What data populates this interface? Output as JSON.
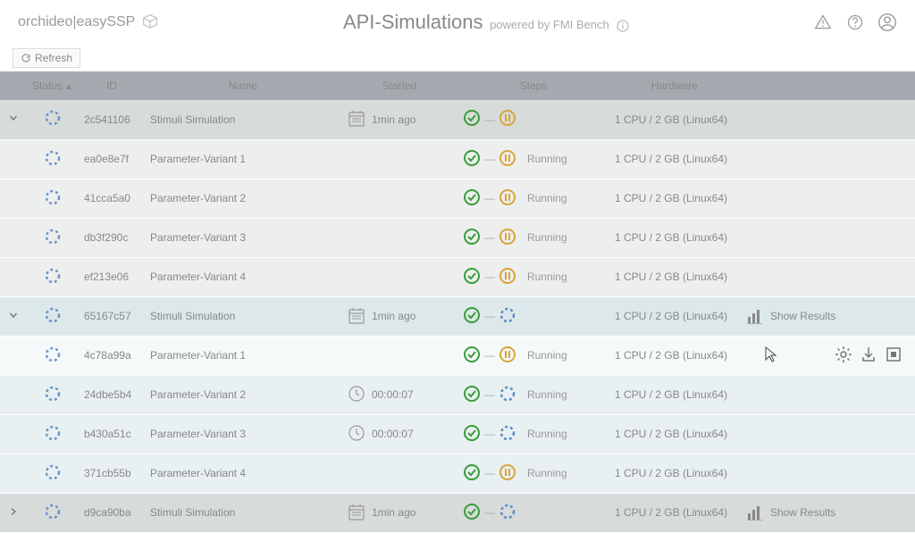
{
  "logo": {
    "text1": "orchideo",
    "sep": " | ",
    "text2": "easySSP"
  },
  "page": {
    "title": "API-Simulations",
    "subtitle": "powered by FMI Bench"
  },
  "toolbar": {
    "refresh": "Refresh"
  },
  "columns": {
    "status": "Status",
    "id": "ID",
    "name": "Name",
    "started": "Started",
    "steps": "Steps",
    "hardware": "Hardware"
  },
  "actions": {
    "showResults": "Show Results"
  },
  "rows": [
    {
      "type": "parent",
      "expand": "down",
      "id": "2c541106",
      "name": "Stimuli Simulation",
      "startedIcon": "cal",
      "started": "1min ago",
      "stepKind": "pause",
      "stepLabel": "",
      "hardware": "1 CPU / 2 GB (Linux64)",
      "actions": ""
    },
    {
      "type": "child",
      "id": "ea0e8e7f",
      "name": "Parameter-Variant 1",
      "started": "",
      "stepKind": "pause",
      "stepLabel": "Running",
      "hardware": "1 CPU / 2 GB (Linux64)",
      "actions": ""
    },
    {
      "type": "child",
      "id": "41cca5a0",
      "name": "Parameter-Variant 2",
      "started": "",
      "stepKind": "pause",
      "stepLabel": "Running",
      "hardware": "1 CPU / 2 GB (Linux64)",
      "actions": ""
    },
    {
      "type": "child",
      "id": "db3f290c",
      "name": "Parameter-Variant 3",
      "started": "",
      "stepKind": "pause",
      "stepLabel": "Running",
      "hardware": "1 CPU / 2 GB (Linux64)",
      "actions": ""
    },
    {
      "type": "child",
      "id": "ef213e06",
      "name": "Parameter-Variant 4",
      "started": "",
      "stepKind": "pause",
      "stepLabel": "Running",
      "hardware": "1 CPU / 2 GB (Linux64)",
      "actions": ""
    },
    {
      "type": "parent-alt",
      "expand": "down",
      "id": "65167c57",
      "name": "Stimuli Simulation",
      "startedIcon": "cal",
      "started": "1min ago",
      "stepKind": "spin",
      "stepLabel": "",
      "hardware": "1 CPU / 2 GB (Linux64)",
      "actions": "results"
    },
    {
      "type": "child-hover",
      "id": "4c78a99a",
      "name": "Parameter-Variant 1",
      "started": "",
      "stepKind": "pause",
      "stepLabel": "Running",
      "hardware": "1 CPU / 2 GB (Linux64)",
      "actions": "icons"
    },
    {
      "type": "child-alt",
      "id": "24dbe5b4",
      "name": "Parameter-Variant 2",
      "startedIcon": "clock",
      "started": "00:00:07",
      "stepKind": "spin",
      "stepLabel": "Running",
      "hardware": "1 CPU / 2 GB (Linux64)",
      "actions": ""
    },
    {
      "type": "child-alt",
      "id": "b430a51c",
      "name": "Parameter-Variant 3",
      "startedIcon": "clock",
      "started": "00:00:07",
      "stepKind": "spin",
      "stepLabel": "Running",
      "hardware": "1 CPU / 2 GB (Linux64)",
      "actions": ""
    },
    {
      "type": "child-alt",
      "id": "371cb55b",
      "name": "Parameter-Variant 4",
      "started": "",
      "stepKind": "pause",
      "stepLabel": "Running",
      "hardware": "1 CPU / 2 GB (Linux64)",
      "actions": ""
    },
    {
      "type": "parent",
      "expand": "right",
      "id": "d9ca90ba",
      "name": "Stimuli Simulation",
      "startedIcon": "cal",
      "started": "1min ago",
      "stepKind": "spin",
      "stepLabel": "",
      "hardware": "1 CPU / 2 GB (Linux64)",
      "actions": "results"
    }
  ]
}
